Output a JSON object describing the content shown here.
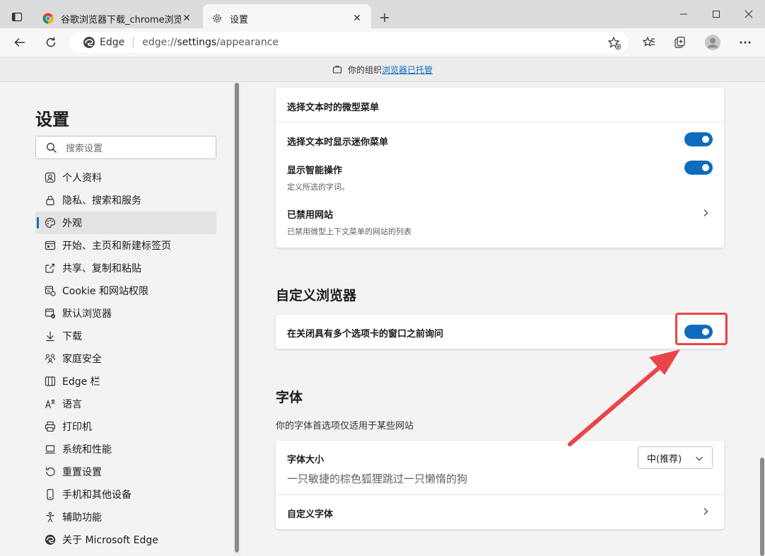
{
  "tabs": [
    {
      "label": "谷歌浏览器下载_chrome浏览器官",
      "active": false
    },
    {
      "label": "设置",
      "active": true
    }
  ],
  "address": {
    "site_label": "Edge",
    "url_prefix": "edge://",
    "url_host": "settings",
    "url_path": "/appearance"
  },
  "infobar": {
    "text": "你的组织",
    "link": "浏览器已托管"
  },
  "sidebar": {
    "title": "设置",
    "search_placeholder": "搜索设置",
    "items": [
      {
        "label": "个人资料",
        "icon": "profile-icon"
      },
      {
        "label": "隐私、搜索和服务",
        "icon": "lock-icon"
      },
      {
        "label": "外观",
        "icon": "palette-icon",
        "active": true
      },
      {
        "label": "开始、主页和新建标签页",
        "icon": "start-page-icon"
      },
      {
        "label": "共享、复制和粘贴",
        "icon": "share-icon"
      },
      {
        "label": "Cookie 和网站权限",
        "icon": "cookie-icon"
      },
      {
        "label": "默认浏览器",
        "icon": "default-browser-icon"
      },
      {
        "label": "下载",
        "icon": "download-icon"
      },
      {
        "label": "家庭安全",
        "icon": "family-icon"
      },
      {
        "label": "Edge 栏",
        "icon": "edge-bar-icon"
      },
      {
        "label": "语言",
        "icon": "language-icon"
      },
      {
        "label": "打印机",
        "icon": "printer-icon"
      },
      {
        "label": "系统和性能",
        "icon": "system-icon"
      },
      {
        "label": "重置设置",
        "icon": "reset-icon"
      },
      {
        "label": "手机和其他设备",
        "icon": "phone-icon"
      },
      {
        "label": "辅助功能",
        "icon": "accessibility-icon"
      },
      {
        "label": "关于 Microsoft Edge",
        "icon": "edge-logo-icon"
      }
    ]
  },
  "mini_menu": {
    "header": "选择文本时的微型菜单",
    "show_mini_menu": "选择文本时显示迷你菜单",
    "smart_actions": "显示智能操作",
    "smart_actions_desc": "定义所选的字词。",
    "blocked_sites": "已禁用网站",
    "blocked_sites_desc": "已禁用微型上下文菜单的网站的列表"
  },
  "customize": {
    "heading": "自定义浏览器",
    "ask_before_close": "在关闭具有多个选项卡的窗口之前询问"
  },
  "fonts": {
    "heading": "字体",
    "subtitle": "你的字体首选项仅适用于某些网站",
    "size_label": "字体大小",
    "size_value": "中(推荐)",
    "sample": "一只敏捷的棕色狐狸跳过一只懒惰的狗",
    "custom_fonts": "自定义字体"
  },
  "colors": {
    "accent": "#0f6cbd",
    "annotation": "#e8454a"
  }
}
